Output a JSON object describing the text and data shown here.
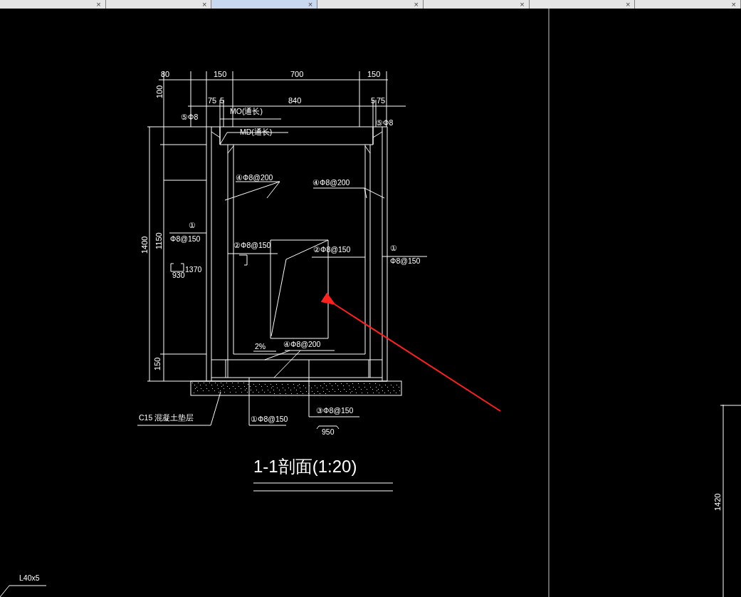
{
  "tabs": [
    {
      "close": "×",
      "selected": false
    },
    {
      "close": "×",
      "selected": false
    },
    {
      "close": "×",
      "selected": true
    },
    {
      "close": "×",
      "selected": false
    },
    {
      "close": "×",
      "selected": false
    },
    {
      "close": "×",
      "selected": false
    },
    {
      "close": "×",
      "selected": false
    }
  ],
  "labels": [
    {
      "kind": "dimension",
      "text": "80"
    },
    {
      "kind": "dimension",
      "text": "150"
    },
    {
      "kind": "dimension",
      "text": "700"
    },
    {
      "kind": "dimension",
      "text": "150"
    },
    {
      "kind": "dimension",
      "text": "100"
    },
    {
      "kind": "dimension",
      "text": "75"
    },
    {
      "kind": "dimension",
      "text": "5"
    },
    {
      "kind": "dimension",
      "text": "840"
    },
    {
      "kind": "dimension",
      "text": "5"
    },
    {
      "kind": "dimension",
      "text": "75"
    },
    {
      "kind": "note",
      "text": "⑤Φ8"
    },
    {
      "kind": "note",
      "text": "MO(通长)"
    },
    {
      "kind": "note",
      "text": "MD(通长)"
    },
    {
      "kind": "note",
      "text": "⑤Φ8"
    },
    {
      "kind": "note",
      "text": "④Φ8@200"
    },
    {
      "kind": "note",
      "text": "④Φ8@200"
    },
    {
      "kind": "note",
      "text": "①"
    },
    {
      "kind": "note",
      "text": "Φ8@150"
    },
    {
      "kind": "dimension",
      "text": "1400"
    },
    {
      "kind": "dimension",
      "text": "1150"
    },
    {
      "kind": "note",
      "text": "1370"
    },
    {
      "kind": "note",
      "text": "930"
    },
    {
      "kind": "note",
      "text": "②Φ8@150"
    },
    {
      "kind": "note",
      "text": "②Φ8@150"
    },
    {
      "kind": "note",
      "text": "①"
    },
    {
      "kind": "note",
      "text": "Φ8@150"
    },
    {
      "kind": "note",
      "text": "2%"
    },
    {
      "kind": "note",
      "text": "④Φ8@200"
    },
    {
      "kind": "dimension",
      "text": "150"
    },
    {
      "kind": "note",
      "text": "C15 混凝土垫层"
    },
    {
      "kind": "note",
      "text": "①Φ8@150"
    },
    {
      "kind": "note",
      "text": "③Φ8@150"
    },
    {
      "kind": "note",
      "text": "950"
    },
    {
      "kind": "title",
      "text": "1-1剖面(1:20)"
    },
    {
      "kind": "note",
      "text": "L40x5"
    },
    {
      "kind": "dimension",
      "text": "1420"
    }
  ]
}
